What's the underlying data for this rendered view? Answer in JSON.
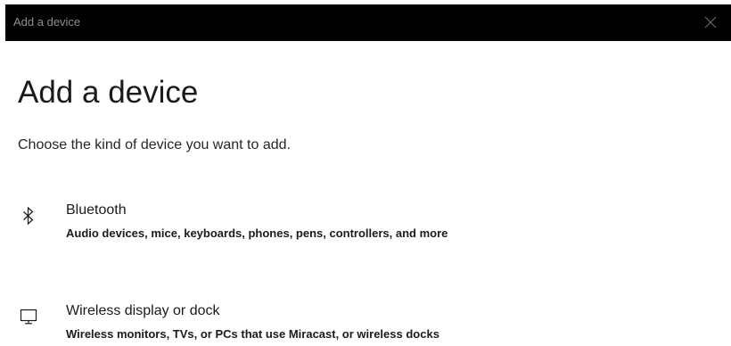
{
  "window": {
    "title": "Add a device"
  },
  "main": {
    "heading": "Add a device",
    "subtitle": "Choose the kind of device you want to add.",
    "options": [
      {
        "icon": "bluetooth-icon",
        "title": "Bluetooth",
        "description": "Audio devices, mice, keyboards, phones, pens, controllers, and more"
      },
      {
        "icon": "monitor-icon",
        "title": "Wireless display or dock",
        "description": "Wireless monitors, TVs, or PCs that use Miracast, or wireless docks"
      }
    ]
  },
  "colors": {
    "titlebar_bg": "#000000",
    "titlebar_text": "#8f8f8f",
    "background": "#ffffff",
    "text": "#1b1b1b"
  }
}
